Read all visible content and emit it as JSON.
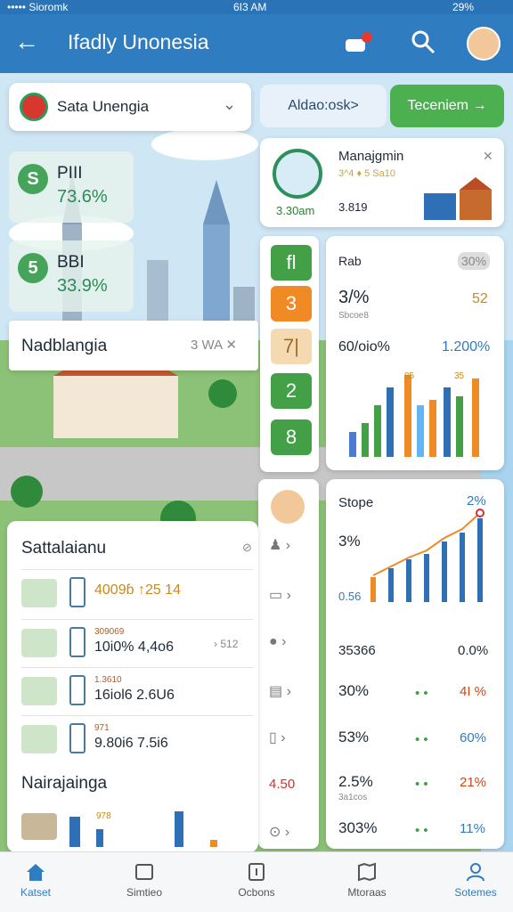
{
  "status": {
    "carrier": "••••• Sioromk",
    "time": "6I3 AM",
    "battery": "29%"
  },
  "app": {
    "title": "Ifadly Unonesia"
  },
  "dropdown": {
    "label": "Sata Unengia"
  },
  "buttons": {
    "light": "Aldao:osk>",
    "green": "Teceniem"
  },
  "stats": [
    {
      "badge": "S",
      "name": "PIII",
      "value": "73.6%"
    },
    {
      "badge": "5",
      "name": "BBI",
      "value": "33.9%"
    }
  ],
  "search_strip": {
    "label": "Nadblangia",
    "icon_text": "3 WA"
  },
  "management": {
    "title": "Manajgmin",
    "sub": "3^4 ♦ 5 Sa10",
    "time": "3.30am",
    "num": "3.819"
  },
  "squares": [
    "fl",
    "3",
    "7|",
    "2",
    "8"
  ],
  "chart_a": {
    "title": "Rab",
    "badge": "30%",
    "v1": "3/%",
    "v1b": "52",
    "v1sub": "Sbcoe8",
    "v2": "60/oio%",
    "v2b": "1.200%",
    "bar_labels": [
      "85",
      "35"
    ]
  },
  "chart_b": {
    "title": "Stope",
    "pct_top": "2%",
    "pct_mid": "3%",
    "pct_low": "0.56",
    "rows": [
      {
        "a": "35366",
        "b": "0.0%"
      },
      {
        "a": "30%",
        "b": "4I %"
      },
      {
        "a": "53%",
        "b": "60%"
      },
      {
        "a": "2.5%",
        "b": "21%",
        "sub": "3a1cos"
      },
      {
        "a": "303%",
        "b": "11%"
      }
    ]
  },
  "side2": {
    "red_val": "4.50"
  },
  "list": {
    "header": "Sattalaianu",
    "items": [
      {
        "small": "",
        "main": "4009ɓ  ↑25 14"
      },
      {
        "small": "309069",
        "main": "10i0% 4,4o6",
        "right": "512"
      },
      {
        "small": "1.3610",
        "main": "16iol6 2.6U6"
      },
      {
        "small": "971",
        "main": "9.80i6 7.5i6"
      }
    ],
    "footer": "Nairajainga",
    "footer_small": "978"
  },
  "nav": [
    {
      "label": "Katset"
    },
    {
      "label": "Simtieo"
    },
    {
      "label": "Ocbons"
    },
    {
      "label": "Mtoraas"
    },
    {
      "label": "Sotemes"
    }
  ],
  "colors": {
    "primary": "#2f7cc0",
    "green": "#4caf50",
    "orange": "#f08a24"
  }
}
